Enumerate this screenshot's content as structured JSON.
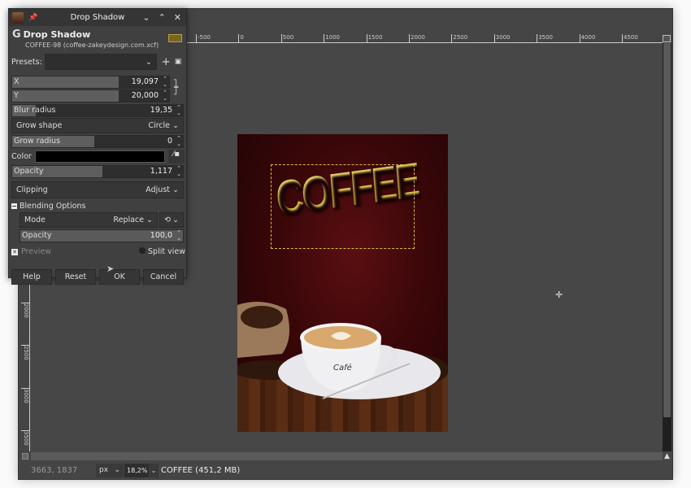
{
  "dialog": {
    "window_title": "Drop Shadow",
    "filter_name": "Drop Shadow",
    "image_name": "COFFEE-98 (coffee-zakeydesign.com.xcf)",
    "presets_label": "Presets:",
    "presets_value": "",
    "x": {
      "label": "X",
      "value": "19,097",
      "fraction": 0.68
    },
    "y": {
      "label": "Y",
      "value": "20,000",
      "fraction": 0.68
    },
    "blur_radius": {
      "label": "Blur radius",
      "value": "19,35",
      "fraction": 0.14
    },
    "grow_shape": {
      "label": "Grow shape",
      "value": "Circle"
    },
    "grow_radius": {
      "label": "Grow radius",
      "value": "0",
      "fraction": 0.48
    },
    "color": {
      "label": "Color",
      "value": "#000000"
    },
    "opacity": {
      "label": "Opacity",
      "value": "1,117",
      "fraction": 0.53
    },
    "clipping": {
      "label": "Clipping",
      "value": "Adjust"
    },
    "blending": {
      "label": "Blending Options",
      "mode_label": "Mode",
      "mode_value": "Replace",
      "opacity_label": "Opacity",
      "opacity_value": "100,0"
    },
    "preview_label": "Preview",
    "preview_checked": true,
    "split_view_label": "Split view",
    "buttons": {
      "help": "Help",
      "reset": "Reset",
      "ok": "OK",
      "cancel": "Cancel"
    },
    "thumb_text": "COFFEE"
  },
  "rulers": {
    "horizontal": [
      "-500",
      "0",
      "500",
      "1000",
      "1500",
      "2000",
      "2500",
      "3000",
      "3500",
      "4000",
      "4500"
    ],
    "vertical": [
      "2000",
      "2500",
      "3000",
      "3500"
    ]
  },
  "canvas": {
    "poster_title": "COFFEE",
    "cup_text": "Café"
  },
  "status": {
    "coords": "3663, 1837",
    "unit": "px",
    "zoom": "18,2%",
    "info": "COFFEE (451,2 MB)"
  }
}
